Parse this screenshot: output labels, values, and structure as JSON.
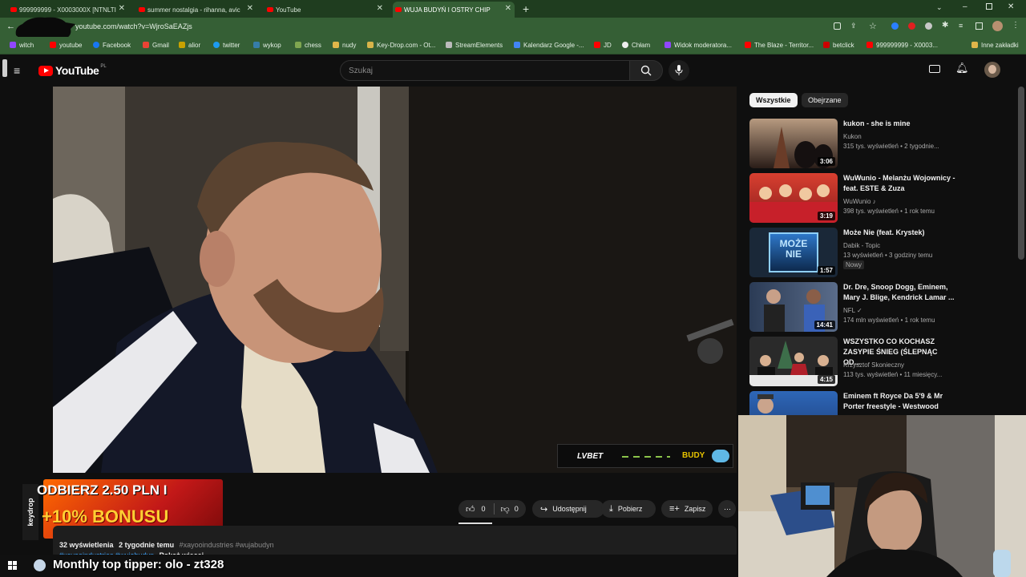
{
  "tabs": [
    {
      "label": "999999999 - X0003000X [NTNLTI"
    },
    {
      "label": "summer nostalgia - rihanna, avic"
    },
    {
      "label": "YouTube"
    },
    {
      "label": "WUJA BUDYŃ I OSTRY CHIP"
    }
  ],
  "address": {
    "url": "youtube.com/watch?v=WjroSaEAZjs"
  },
  "bookmarks": [
    {
      "label": "witch",
      "color": "#9146ff"
    },
    {
      "label": "youtube",
      "color": "#ff0000"
    },
    {
      "label": "Facebook",
      "color": "#1877f2"
    },
    {
      "label": "Gmail",
      "color": "#ea4335"
    },
    {
      "label": "alior",
      "color": "#c8a200"
    },
    {
      "label": "twitter",
      "color": "#1d9bf0"
    },
    {
      "label": "wykop",
      "color": "#367da8"
    },
    {
      "label": "chess",
      "color": "#7fa650"
    },
    {
      "label": "nudy",
      "color": "#e0b64a"
    },
    {
      "label": "Key-Drop.com - Ot...",
      "color": "#d8b44a"
    },
    {
      "label": "StreamElements",
      "color": "#bbbbbb"
    },
    {
      "label": "Kalendarz Google -...",
      "color": "#4285f4"
    },
    {
      "label": "JD",
      "color": "#ff0000"
    },
    {
      "label": "Chłam",
      "color": "#eeeeee"
    },
    {
      "label": "Widok moderatora...",
      "color": "#9146ff"
    },
    {
      "label": "The Blaze - Territor...",
      "color": "#ff0000"
    },
    {
      "label": "betclick",
      "color": "#cc0000"
    },
    {
      "label": "999999999 - X0003...",
      "color": "#ff0000"
    },
    {
      "label": "Inne zakładki",
      "color": "#e0b64a"
    }
  ],
  "youtube": {
    "logo": "YouTube",
    "region": "PL",
    "search_placeholder": "Szukaj"
  },
  "overlay": {
    "badge": "LVBET",
    "brand": "BUDY",
    "promo_line1": "ODBIERZ 2.50 PLN I",
    "promo_line2": "+10% BONUSU",
    "promo_side": "keydrop",
    "ticker": "Monthly top tipper: olo - zt328"
  },
  "actions": {
    "likes": "0",
    "dislikes": "0",
    "share": "Udostępnij",
    "download": "Pobierz",
    "save": "Zapisz"
  },
  "description": {
    "views": "32 wyświetlenia",
    "date": "2 tygodnie temu",
    "tags": "#xayooindustries #wujabudyn",
    "tags2": "#xayooindustries #wujabudyn",
    "more": "Pokaż więcej"
  },
  "sidebar": {
    "chips": [
      "Wszystkie",
      "Obejrzane"
    ],
    "items": [
      {
        "title": "kukon - she is mine",
        "channel": "Kukon",
        "meta": "315 tys. wyświetleń • 2 tygodnie...",
        "duration": "3:06"
      },
      {
        "title": "WuWunio - Melanżu Wojownicy - feat. ESTE & Zuza",
        "channel": "WuWunio ♪",
        "meta": "398 tys. wyświetleń • 1 rok temu",
        "duration": "3:19"
      },
      {
        "title": "Może Nie (feat. Krystek)",
        "channel": "Dabik - Topic",
        "meta": "13 wyświetleń • 3 godziny temu",
        "badge": "Nowy",
        "duration": "1:57",
        "thumb_text": "MOŻE NIE"
      },
      {
        "title": "Dr. Dre, Snoop Dogg, Eminem, Mary J. Blige, Kendrick Lamar ...",
        "channel": "NFL ✓",
        "meta": "174 mln wyświetleń • 1 rok temu",
        "duration": "14:41"
      },
      {
        "title": "WSZYSTKO CO KOCHASZ ZASYPIE ŚNIEG (ŚLEPNĄC OD...",
        "channel": "Krzysztof Skonieczny",
        "meta": "113 tys. wyświetleń • 11 miesięcy...",
        "duration": "4:15"
      },
      {
        "title": "Eminem ft Royce Da 5'9 & Mr Porter freestyle - Westwood",
        "channel": "",
        "meta": "",
        "duration": ""
      }
    ]
  }
}
